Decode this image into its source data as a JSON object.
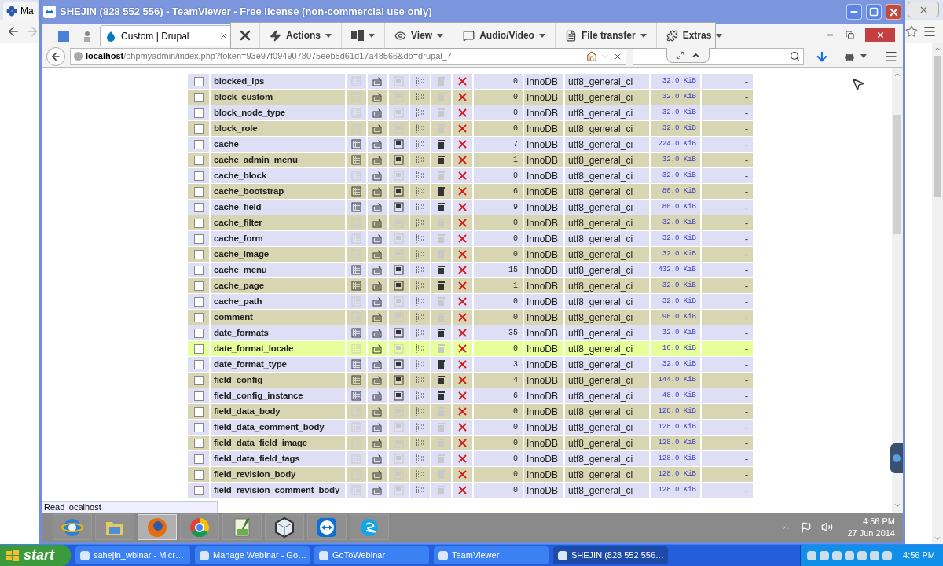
{
  "background_browser": {
    "tab_title": "Ma"
  },
  "teamviewer": {
    "title": "SHEJIN (828 552 556) - TeamViewer - Free license (non-commercial use only)",
    "toolbar": [
      {
        "kind": "close"
      },
      {
        "kind": "menu",
        "label": "Actions"
      },
      {
        "kind": "icon-menu"
      },
      {
        "kind": "menu",
        "label": "View"
      },
      {
        "kind": "menu",
        "label": "Audio/Video"
      },
      {
        "kind": "menu",
        "label": "File transfer"
      },
      {
        "kind": "menu",
        "label": "Extras"
      }
    ]
  },
  "firefox": {
    "tabs": [
      {
        "label": "Custom | Drupal",
        "selected": true
      }
    ],
    "url": "**localhost**/phpmyadmin/index.php?token=93e97f0949078075eeb5d61d17a48566&db=drupal_7",
    "status": "Read localhost"
  },
  "table": {
    "rows": [
      {
        "checked": false,
        "name": "blocked_ips",
        "count": "0",
        "engine": "InnoDB",
        "collation": "utf8_general_ci",
        "size": "32.0 KiB",
        "overhead": "-",
        "empty": true,
        "highlighted": false
      },
      {
        "checked": false,
        "name": "block_custom",
        "count": "0",
        "engine": "InnoDB",
        "collation": "utf8_general_ci",
        "size": "32.0 KiB",
        "overhead": "-",
        "empty": true,
        "highlighted": false
      },
      {
        "checked": false,
        "name": "block_node_type",
        "count": "0",
        "engine": "InnoDB",
        "collation": "utf8_general_ci",
        "size": "32.0 KiB",
        "overhead": "-",
        "empty": true,
        "highlighted": false
      },
      {
        "checked": false,
        "name": "block_role",
        "count": "0",
        "engine": "InnoDB",
        "collation": "utf8_general_ci",
        "size": "32.0 KiB",
        "overhead": "-",
        "empty": true,
        "highlighted": false
      },
      {
        "checked": false,
        "name": "cache",
        "count": "7",
        "engine": "InnoDB",
        "collation": "utf8_general_ci",
        "size": "224.0 KiB",
        "overhead": "-",
        "empty": false,
        "highlighted": false
      },
      {
        "checked": false,
        "name": "cache_admin_menu",
        "count": "1",
        "engine": "InnoDB",
        "collation": "utf8_general_ci",
        "size": "32.0 KiB",
        "overhead": "-",
        "empty": false,
        "highlighted": false
      },
      {
        "checked": false,
        "name": "cache_block",
        "count": "0",
        "engine": "InnoDB",
        "collation": "utf8_general_ci",
        "size": "32.0 KiB",
        "overhead": "-",
        "empty": true,
        "highlighted": false
      },
      {
        "checked": false,
        "name": "cache_bootstrap",
        "count": "6",
        "engine": "InnoDB",
        "collation": "utf8_general_ci",
        "size": "80.0 KiB",
        "overhead": "-",
        "empty": false,
        "highlighted": false
      },
      {
        "checked": false,
        "name": "cache_field",
        "count": "9",
        "engine": "InnoDB",
        "collation": "utf8_general_ci",
        "size": "80.0 KiB",
        "overhead": "-",
        "empty": false,
        "highlighted": false
      },
      {
        "checked": false,
        "name": "cache_filter",
        "count": "0",
        "engine": "InnoDB",
        "collation": "utf8_general_ci",
        "size": "32.0 KiB",
        "overhead": "-",
        "empty": true,
        "highlighted": false
      },
      {
        "checked": false,
        "name": "cache_form",
        "count": "0",
        "engine": "InnoDB",
        "collation": "utf8_general_ci",
        "size": "32.0 KiB",
        "overhead": "-",
        "empty": true,
        "highlighted": false
      },
      {
        "checked": false,
        "name": "cache_image",
        "count": "0",
        "engine": "InnoDB",
        "collation": "utf8_general_ci",
        "size": "32.0 KiB",
        "overhead": "-",
        "empty": true,
        "highlighted": false
      },
      {
        "checked": false,
        "name": "cache_menu",
        "count": "15",
        "engine": "InnoDB",
        "collation": "utf8_general_ci",
        "size": "432.0 KiB",
        "overhead": "-",
        "empty": false,
        "highlighted": false
      },
      {
        "checked": false,
        "name": "cache_page",
        "count": "1",
        "engine": "InnoDB",
        "collation": "utf8_general_ci",
        "size": "32.0 KiB",
        "overhead": "-",
        "empty": false,
        "highlighted": false
      },
      {
        "checked": false,
        "name": "cache_path",
        "count": "0",
        "engine": "InnoDB",
        "collation": "utf8_general_ci",
        "size": "32.0 KiB",
        "overhead": "-",
        "empty": true,
        "highlighted": false
      },
      {
        "checked": false,
        "name": "comment",
        "count": "0",
        "engine": "InnoDB",
        "collation": "utf8_general_ci",
        "size": "96.0 KiB",
        "overhead": "-",
        "empty": true,
        "highlighted": false
      },
      {
        "checked": false,
        "name": "date_formats",
        "count": "35",
        "engine": "InnoDB",
        "collation": "utf8_general_ci",
        "size": "32.0 KiB",
        "overhead": "-",
        "empty": false,
        "highlighted": false
      },
      {
        "checked": false,
        "name": "date_format_locale",
        "count": "0",
        "engine": "InnoDB",
        "collation": "utf8_general_ci",
        "size": "16.0 KiB",
        "overhead": "-",
        "empty": true,
        "highlighted": true
      },
      {
        "checked": false,
        "name": "date_format_type",
        "count": "3",
        "engine": "InnoDB",
        "collation": "utf8_general_ci",
        "size": "32.0 KiB",
        "overhead": "-",
        "empty": false,
        "highlighted": false
      },
      {
        "checked": false,
        "name": "field_config",
        "count": "4",
        "engine": "InnoDB",
        "collation": "utf8_general_ci",
        "size": "144.0 KiB",
        "overhead": "-",
        "empty": false,
        "highlighted": false
      },
      {
        "checked": false,
        "name": "field_config_instance",
        "count": "6",
        "engine": "InnoDB",
        "collation": "utf8_general_ci",
        "size": "48.0 KiB",
        "overhead": "-",
        "empty": false,
        "highlighted": false
      },
      {
        "checked": false,
        "name": "field_data_body",
        "count": "0",
        "engine": "InnoDB",
        "collation": "utf8_general_ci",
        "size": "128.0 KiB",
        "overhead": "-",
        "empty": true,
        "highlighted": false
      },
      {
        "checked": false,
        "name": "field_data_comment_body",
        "count": "0",
        "engine": "InnoDB",
        "collation": "utf8_general_ci",
        "size": "128.0 KiB",
        "overhead": "-",
        "empty": true,
        "highlighted": false
      },
      {
        "checked": false,
        "name": "field_data_field_image",
        "count": "0",
        "engine": "InnoDB",
        "collation": "utf8_general_ci",
        "size": "128.0 KiB",
        "overhead": "-",
        "empty": true,
        "highlighted": false
      },
      {
        "checked": false,
        "name": "field_data_field_tags",
        "count": "0",
        "engine": "InnoDB",
        "collation": "utf8_general_ci",
        "size": "128.0 KiB",
        "overhead": "-",
        "empty": true,
        "highlighted": false
      },
      {
        "checked": false,
        "name": "field_revision_body",
        "count": "0",
        "engine": "InnoDB",
        "collation": "utf8_general_ci",
        "size": "128.0 KiB",
        "overhead": "-",
        "empty": true,
        "highlighted": false
      },
      {
        "checked": false,
        "name": "field_revision_comment_body",
        "count": "0",
        "engine": "InnoDB",
        "collation": "utf8_general_ci",
        "size": "128.0 KiB",
        "overhead": "-",
        "empty": true,
        "highlighted": false
      }
    ]
  },
  "remote_taskbar": {
    "apps": [
      {
        "selected": false
      },
      {
        "selected": false
      },
      {
        "selected": true
      },
      {
        "selected": false
      },
      {
        "selected": false
      },
      {
        "selected": false
      },
      {
        "selected": false
      },
      {
        "selected": false
      }
    ],
    "time": "4:56 PM",
    "date": "27 Jun 2014"
  },
  "taskbar": {
    "start": "start",
    "tasks": [
      {
        "label": "sahejin_wbinar - Micr…",
        "selected": false
      },
      {
        "label": "Manage Webinar - Go…",
        "selected": false
      },
      {
        "label": "GoToWebinar",
        "selected": false
      },
      {
        "label": "TeamViewer",
        "selected": false
      },
      {
        "label": "SHEJIN (828 552 556…",
        "selected": true
      }
    ],
    "time": "4:56 PM"
  }
}
